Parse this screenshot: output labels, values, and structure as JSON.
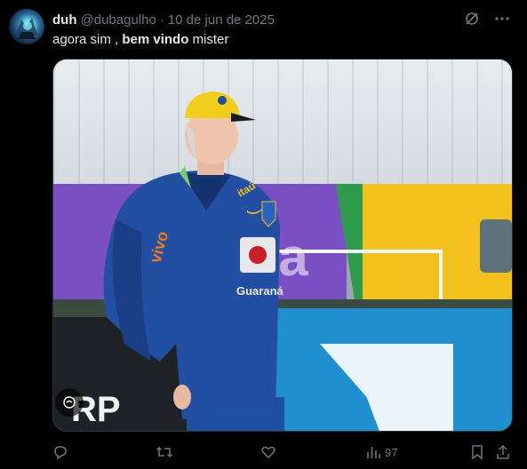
{
  "author": {
    "name": "duh",
    "handle": "@dubagulho",
    "separator": "·",
    "date": "10 de jun de 2025"
  },
  "tweet": {
    "text_plain_1": "agora sim ,",
    "text_bold": "bem vindo",
    "text_plain_2": "mister"
  },
  "media": {
    "banner_text": "ra",
    "board_text": "RP",
    "jersey_brand": "vivo",
    "jersey_sponsor": "Guaraná",
    "jersey_badge": "itaú"
  },
  "actions": {
    "views": "97"
  },
  "colors": {
    "background": "#000000",
    "text_primary": "#e7e9ea",
    "text_secondary": "#71767b"
  },
  "icons": {
    "grok": "grok-icon",
    "more": "more-icon",
    "reply": "reply-icon",
    "retweet": "retweet-icon",
    "like": "like-icon",
    "views": "views-icon",
    "bookmark": "bookmark-icon",
    "share": "share-icon",
    "alt": "alt-icon"
  }
}
